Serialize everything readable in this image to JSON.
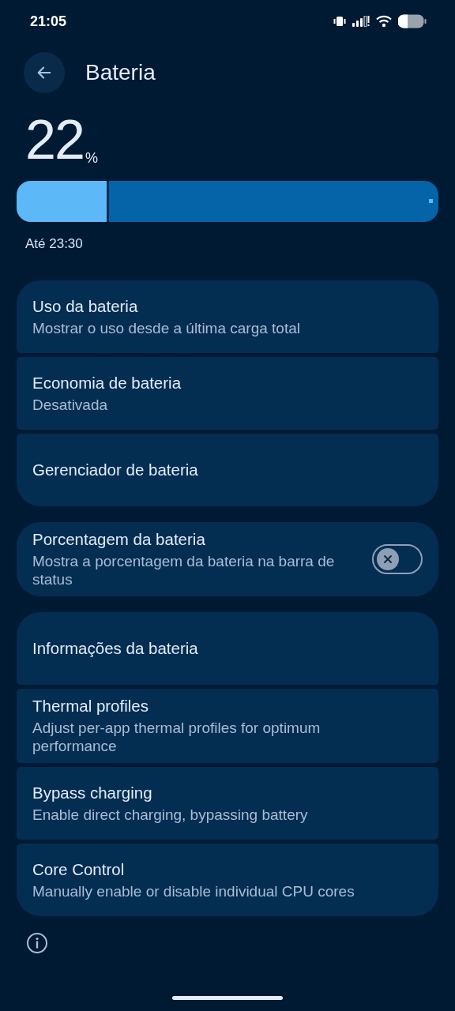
{
  "status_bar": {
    "time": "21:05"
  },
  "header": {
    "title": "Bateria"
  },
  "battery": {
    "percent": "22",
    "unit": "%",
    "level": 0.22,
    "estimate": "Até 23:30"
  },
  "groups": [
    {
      "items": [
        {
          "title": "Uso da bateria",
          "subtitle": "Mostrar o uso desde a última carga total"
        },
        {
          "title": "Economia de bateria",
          "subtitle": "Desativada"
        },
        {
          "title": "Gerenciador de bateria"
        }
      ]
    },
    {
      "items": [
        {
          "title": "Porcentagem da bateria",
          "subtitle": "Mostra a porcentagem da bateria na barra de status",
          "toggle": {
            "on": false
          }
        }
      ]
    },
    {
      "items": [
        {
          "title": "Informações da bateria"
        },
        {
          "title": "Thermal profiles",
          "subtitle": "Adjust per-app thermal profiles for optimum performance"
        },
        {
          "title": "Bypass charging",
          "subtitle": "Enable direct charging, bypassing battery"
        },
        {
          "title": "Core Control",
          "subtitle": "Manually enable or disable individual CPU cores"
        }
      ]
    }
  ]
}
